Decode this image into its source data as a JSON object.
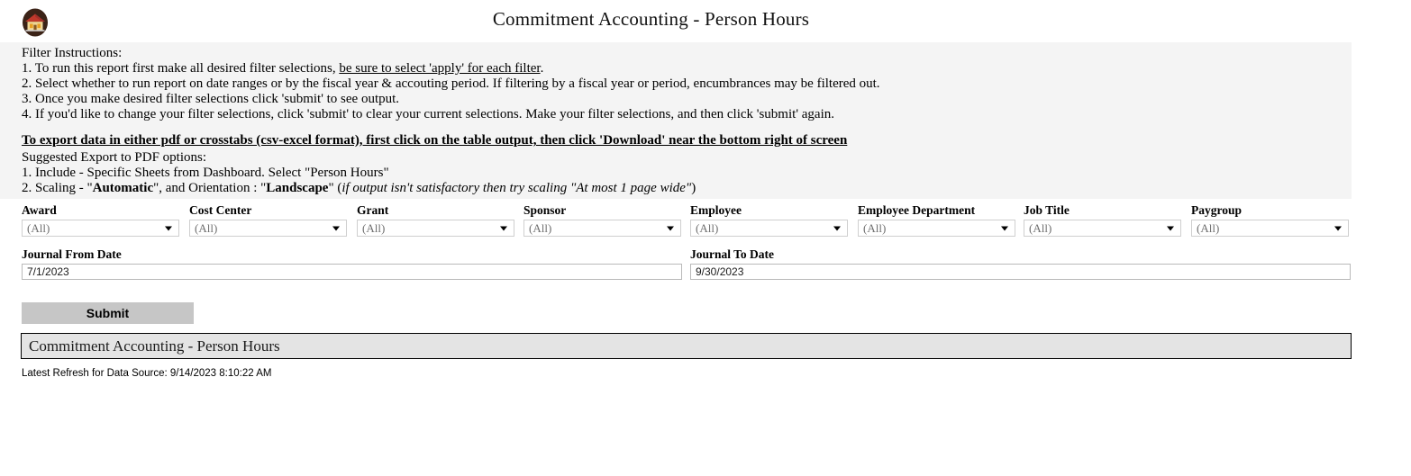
{
  "header": {
    "title": "Commitment Accounting - Person Hours",
    "logo_icon": "home-icon"
  },
  "instructions": {
    "heading": "Filter Instructions:",
    "item1_pre": "1. To run this report first make all desired filter selections, ",
    "item1_link": "be sure to select 'apply' for each filter",
    "item1_post": ".",
    "item2": "2. Select whether to run report on date ranges or by the fiscal year & accouting period. If filtering by a fiscal year or period, encumbrances may be filtered out.",
    "item3": "3. Once you make desired filter selections click 'submit' to see output.",
    "item4": "4. If you'd like to change your filter selections, click 'submit' to clear your current selections. Make your filter selections, and then click 'submit' again.",
    "export_heading": "To export data in either pdf or crosstabs (csv-excel format), first click on the table output, then click 'Download' near the bottom right of screen",
    "pdf_heading": "Suggested Export to PDF options:",
    "pdf_item1": "1. Include - Specific Sheets from Dashboard. Select \"Person Hours\"",
    "pdf_item2_a": "2. Scaling - \"",
    "pdf_item2_b": "Automatic",
    "pdf_item2_c": "\", and Orientation : \"",
    "pdf_item2_d": "Landscape",
    "pdf_item2_e": "\" (",
    "pdf_item2_f": "if output isn't satisfactory then try scaling \"At most 1 page wide\"",
    "pdf_item2_g": ")"
  },
  "filters": [
    {
      "label": "Award",
      "value": "(All)"
    },
    {
      "label": "Cost Center",
      "value": "(All)"
    },
    {
      "label": "Grant",
      "value": "(All)"
    },
    {
      "label": "Sponsor",
      "value": "(All)"
    },
    {
      "label": "Employee",
      "value": "(All)"
    },
    {
      "label": "Employee Department",
      "value": "(All)"
    },
    {
      "label": "Job Title",
      "value": "(All)"
    },
    {
      "label": "Paygroup",
      "value": "(All)"
    }
  ],
  "dates": {
    "from_label": "Journal From Date",
    "from_value": "7/1/2023",
    "to_label": "Journal To Date",
    "to_value": "9/30/2023"
  },
  "submit": {
    "label": "Submit"
  },
  "report": {
    "title": "Commitment Accounting - Person Hours"
  },
  "footer": {
    "refresh_text": "Latest Refresh for Data Source: 9/14/2023 8:10:22 AM"
  },
  "colors": {
    "instructions_bg": "#f4f4f4",
    "report_title_bg": "#e4e4e4",
    "submit_bg": "#c6c6c6",
    "logo_circle": "#3b2317",
    "logo_roof": "#c0392b",
    "logo_wall": "#f0d898"
  }
}
